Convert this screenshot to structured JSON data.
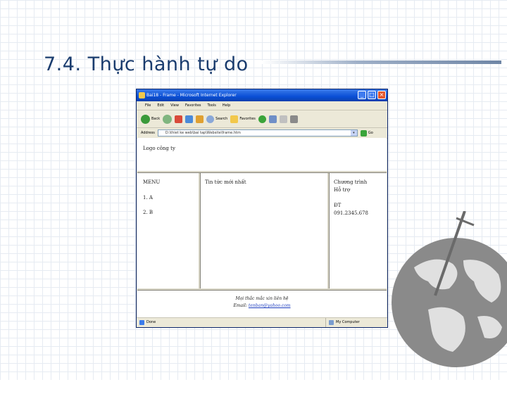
{
  "slide": {
    "title": "7.4. Thực hành tự do"
  },
  "window": {
    "title": "Bai18 - Frame - Microsoft Internet Explorer",
    "buttons": {
      "minimize": "_",
      "maximize": "□",
      "close": "×"
    }
  },
  "menu": [
    "File",
    "Edit",
    "View",
    "Favorites",
    "Tools",
    "Help"
  ],
  "toolbar": {
    "back": "Back",
    "search": "Search",
    "favorites": "Favorites"
  },
  "address": {
    "label": "Address",
    "value": "D:\\thiet ke web\\bai tap\\Website\\frame.htm",
    "go": "Go"
  },
  "frames": {
    "top": {
      "logo": "Logo công ty"
    },
    "left": {
      "menu": "MENU",
      "item1": "1. A",
      "item2": "2. B"
    },
    "mid": {
      "heading": "Tin tức mới nhất"
    },
    "right": {
      "line1": "Chương trình",
      "line2": "Hỗ trợ",
      "line3": "ĐT",
      "line4": "091.2345.678"
    },
    "bottom": {
      "line1": "Mọi thắc mắc xin liên hệ",
      "email_label": "Email: ",
      "email": "tenban@yahoo.com"
    }
  },
  "status": {
    "left": "Done",
    "right": "My Computer"
  },
  "colors": {
    "title": "#1a3c6e",
    "ie_titlebar": "#0a4fd6",
    "link": "#1f3fbf"
  }
}
